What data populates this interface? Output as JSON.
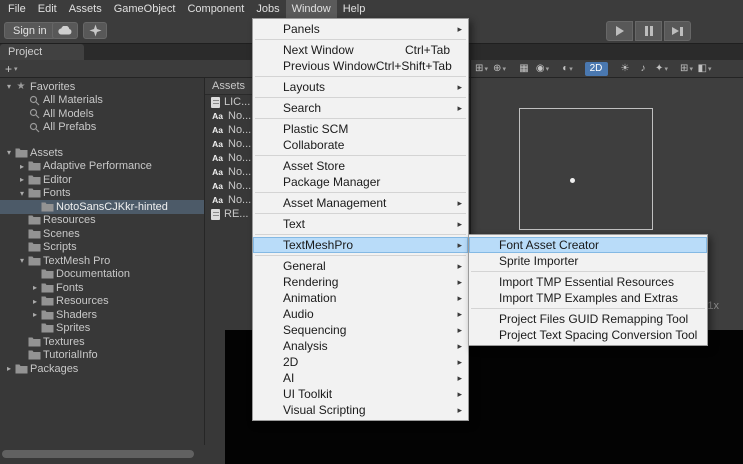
{
  "menubar": {
    "items": [
      {
        "label": "File"
      },
      {
        "label": "Edit"
      },
      {
        "label": "Assets"
      },
      {
        "label": "GameObject"
      },
      {
        "label": "Component"
      },
      {
        "label": "Jobs"
      },
      {
        "label": "Window",
        "class": "active"
      },
      {
        "label": "Help"
      }
    ]
  },
  "toolbar": {
    "sign_in": "Sign in"
  },
  "project_tab": {
    "label": "Project"
  },
  "project_toolbar": {
    "add": "+",
    "dropdown": "▾"
  },
  "icons": {
    "font_glyph": "Aa"
  },
  "project": {
    "assets_header": "Assets",
    "tree": [
      {
        "label": "Favorites",
        "icon": "star",
        "arrow": "▾",
        "indent": 4
      },
      {
        "label": "All Materials",
        "icon": "search",
        "arrow": "",
        "indent": 17
      },
      {
        "label": "All Models",
        "icon": "search",
        "arrow": "",
        "indent": 17
      },
      {
        "label": "All Prefabs",
        "icon": "search",
        "arrow": "",
        "indent": 17
      },
      {
        "label": "Assets",
        "icon": "folder",
        "arrow": "▾",
        "indent": 4,
        "class": "gap-before"
      },
      {
        "label": "Adaptive Performance",
        "icon": "folder",
        "arrow": "▸",
        "indent": 17
      },
      {
        "label": "Editor",
        "icon": "folder",
        "arrow": "▸",
        "indent": 17
      },
      {
        "label": "Fonts",
        "icon": "folder",
        "arrow": "▾",
        "indent": 17
      },
      {
        "label": "NotoSansCJKkr-hinted",
        "icon": "folder",
        "arrow": "",
        "indent": 30,
        "class": "selected"
      },
      {
        "label": "Resources",
        "icon": "folder",
        "arrow": "",
        "indent": 17
      },
      {
        "label": "Scenes",
        "icon": "folder",
        "arrow": "",
        "indent": 17
      },
      {
        "label": "Scripts",
        "icon": "folder",
        "arrow": "",
        "indent": 17
      },
      {
        "label": "TextMesh Pro",
        "icon": "folder",
        "arrow": "▾",
        "indent": 17
      },
      {
        "label": "Documentation",
        "icon": "folder",
        "arrow": "",
        "indent": 30
      },
      {
        "label": "Fonts",
        "icon": "folder",
        "arrow": "▸",
        "indent": 30
      },
      {
        "label": "Resources",
        "icon": "folder",
        "arrow": "▸",
        "indent": 30
      },
      {
        "label": "Shaders",
        "icon": "folder",
        "arrow": "▸",
        "indent": 30
      },
      {
        "label": "Sprites",
        "icon": "folder",
        "arrow": "",
        "indent": 30
      },
      {
        "label": "Textures",
        "icon": "folder",
        "arrow": "",
        "indent": 17
      },
      {
        "label": "TutorialInfo",
        "icon": "folder",
        "arrow": "",
        "indent": 17
      },
      {
        "label": "Packages",
        "icon": "folder",
        "arrow": "▸",
        "indent": 4
      }
    ],
    "files": [
      {
        "icon": "text",
        "label": "LIC..."
      },
      {
        "icon": "font",
        "label": "No..."
      },
      {
        "icon": "font",
        "label": "No..."
      },
      {
        "icon": "font",
        "label": "No..."
      },
      {
        "icon": "font",
        "label": "No..."
      },
      {
        "icon": "font",
        "label": "No..."
      },
      {
        "icon": "font",
        "label": "No..."
      },
      {
        "icon": "font",
        "label": "No..."
      },
      {
        "icon": "text",
        "label": "RE..."
      }
    ]
  },
  "window_menu": {
    "items": [
      {
        "label": "Panels",
        "shortcut": "",
        "caret": "▸",
        "class": "sep-after"
      },
      {
        "label": "Next Window",
        "shortcut": "Ctrl+Tab",
        "caret": ""
      },
      {
        "label": "Previous Window",
        "shortcut": "Ctrl+Shift+Tab",
        "caret": "",
        "class": "sep-after"
      },
      {
        "label": "Layouts",
        "shortcut": "",
        "caret": "▸",
        "class": "sep-after"
      },
      {
        "label": "Search",
        "shortcut": "",
        "caret": "▸",
        "class": "sep-after"
      },
      {
        "label": "Plastic SCM",
        "shortcut": "",
        "caret": ""
      },
      {
        "label": "Collaborate",
        "shortcut": "",
        "caret": "",
        "class": "sep-after"
      },
      {
        "label": "Asset Store",
        "shortcut": "",
        "caret": ""
      },
      {
        "label": "Package Manager",
        "shortcut": "",
        "caret": "",
        "class": "sep-after"
      },
      {
        "label": "Asset Management",
        "shortcut": "",
        "caret": "▸",
        "class": "sep-after"
      },
      {
        "label": "Text",
        "shortcut": "",
        "caret": "▸",
        "class": "sep-after"
      },
      {
        "label": "TextMeshPro",
        "shortcut": "",
        "caret": "▸",
        "class": "hl sep-after"
      },
      {
        "label": "General",
        "shortcut": "",
        "caret": "▸"
      },
      {
        "label": "Rendering",
        "shortcut": "",
        "caret": "▸"
      },
      {
        "label": "Animation",
        "shortcut": "",
        "caret": "▸"
      },
      {
        "label": "Audio",
        "shortcut": "",
        "caret": "▸"
      },
      {
        "label": "Sequencing",
        "shortcut": "",
        "caret": "▸"
      },
      {
        "label": "Analysis",
        "shortcut": "",
        "caret": "▸"
      },
      {
        "label": "2D",
        "shortcut": "",
        "caret": "▸"
      },
      {
        "label": "AI",
        "shortcut": "",
        "caret": "▸"
      },
      {
        "label": "UI Toolkit",
        "shortcut": "",
        "caret": "▸"
      },
      {
        "label": "Visual Scripting",
        "shortcut": "",
        "caret": "▸"
      }
    ]
  },
  "tmp_submenu": {
    "items": [
      {
        "label": "Font Asset Creator",
        "shortcut": "",
        "caret": "",
        "class": "hl"
      },
      {
        "label": "Sprite Importer",
        "shortcut": "",
        "caret": "",
        "class": "sep-after"
      },
      {
        "label": "Import TMP Essential Resources",
        "shortcut": "",
        "caret": ""
      },
      {
        "label": "Import TMP Examples and Extras",
        "shortcut": "",
        "caret": "",
        "class": "sep-after"
      },
      {
        "label": "Project Files GUID Remapping Tool",
        "shortcut": "",
        "caret": ""
      },
      {
        "label": "Project Text Spacing Conversion Tool",
        "shortcut": "",
        "caret": ""
      }
    ]
  },
  "scene": {
    "scale_label": "1x",
    "toolbar_buttons": [
      {
        "glyph": "⊞",
        "arrow": "▾"
      },
      {
        "glyph": "⊕",
        "arrow": "▾"
      },
      {
        "glyph": "▦",
        "arrow": "",
        "class": "gap"
      },
      {
        "glyph": "◉",
        "arrow": "▾"
      },
      {
        "glyph": "◐",
        "arrow": "▾",
        "class": "gap"
      },
      {
        "glyph": "2D",
        "arrow": "",
        "class": "btn2d gap"
      },
      {
        "glyph": "☀",
        "arrow": "",
        "class": "gap"
      },
      {
        "glyph": "♪",
        "arrow": ""
      },
      {
        "glyph": "✦",
        "arrow": "▾"
      },
      {
        "glyph": "⊞",
        "arrow": "▾",
        "class": "gap"
      },
      {
        "glyph": "◧",
        "arrow": "▾"
      }
    ]
  }
}
